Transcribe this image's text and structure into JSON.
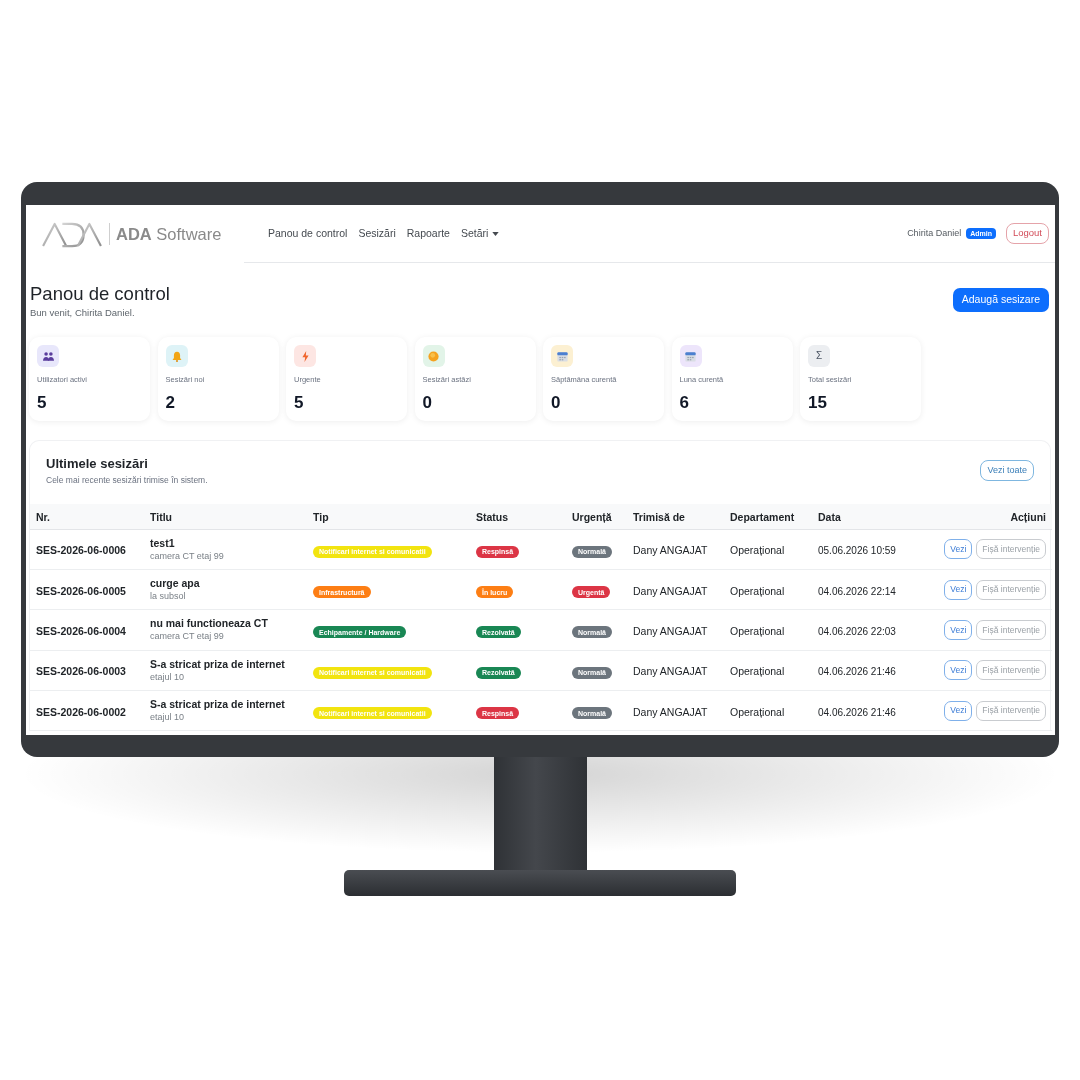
{
  "header": {
    "brand": "**ADA** Software",
    "nav": [
      {
        "label": "Panou de control",
        "dropdown": false
      },
      {
        "label": "Sesizări",
        "dropdown": false
      },
      {
        "label": "Rapoarte",
        "dropdown": false
      },
      {
        "label": "Setări",
        "dropdown": true
      }
    ],
    "user": {
      "name": "Chirita Daniel",
      "role": "Admin"
    },
    "logout": "Logout"
  },
  "page": {
    "title": "Panou de control",
    "subtitle": "Bun venit, Chirita Daniel.",
    "add_button": "Adaugă sesizare"
  },
  "stats": [
    {
      "kind": "users",
      "color": "#e8e7fb",
      "label": "Utilizatori activi",
      "value": "5"
    },
    {
      "kind": "bell",
      "color": "#def3f7",
      "label": "Sesizări noi",
      "value": "2"
    },
    {
      "kind": "bolt",
      "color": "#fde6e3",
      "label": "Urgente",
      "value": "5"
    },
    {
      "kind": "sun",
      "color": "#e2f4e8",
      "label": "Sesizări astăzi",
      "value": "0"
    },
    {
      "kind": "calendar",
      "color": "#fcf0d2",
      "label": "Săptămâna curentă",
      "value": "0"
    },
    {
      "kind": "calendar",
      "color": "#ede5fb",
      "label": "Luna curentă",
      "value": "6"
    },
    {
      "kind": "symbol",
      "symbol": "Σ",
      "color": "#eceef1",
      "label": "Total sesizări",
      "value": "15"
    }
  ],
  "recent": {
    "title": "Ultimele sesizări",
    "subtitle": "Cele mai recente sesizări trimise în sistem.",
    "view_all": "Vezi toate",
    "columns": [
      "Nr.",
      "Titlu",
      "Tip",
      "Status",
      "Urgență",
      "Trimisă de",
      "Departament",
      "Data",
      "Acțiuni"
    ],
    "rows": [
      {
        "nr": "SES-2026-06-0006",
        "title": "test1",
        "location": "camera CT etaj 99",
        "type": {
          "label": "Notificari internet si comunicatii",
          "color": "#f2e40f"
        },
        "status": {
          "label": "Respinsă",
          "color": "#dc3545"
        },
        "urgency": {
          "label": "Normală",
          "color": "#6c757d"
        },
        "sender": "Dany ANGAJAT",
        "department": "Operațional",
        "date": "05.06.2026 10:59",
        "actions": [
          {
            "kind": "view",
            "label": "Vezi"
          },
          {
            "kind": "sheet",
            "label": "Fișă intervenție"
          }
        ]
      },
      {
        "nr": "SES-2026-06-0005",
        "title": "curge apa",
        "location": "la subsol",
        "type": {
          "label": "Infrastructură",
          "color": "#fd7e14"
        },
        "status": {
          "label": "În lucru",
          "color": "#fd7e14"
        },
        "urgency": {
          "label": "Urgentă",
          "color": "#dc3545"
        },
        "sender": "Dany ANGAJAT",
        "department": "Operațional",
        "date": "04.06.2026 22:14",
        "actions": [
          {
            "kind": "view",
            "label": "Vezi"
          },
          {
            "kind": "sheet",
            "label": "Fișă intervenție"
          }
        ]
      },
      {
        "nr": "SES-2026-06-0004",
        "title": "nu mai functioneaza CT",
        "location": "camera CT etaj 99",
        "type": {
          "label": "Echipamente / Hardware",
          "color": "#198754"
        },
        "status": {
          "label": "Rezolvată",
          "color": "#198754"
        },
        "urgency": {
          "label": "Normală",
          "color": "#6c757d"
        },
        "sender": "Dany ANGAJAT",
        "department": "Operațional",
        "date": "04.06.2026 22:03",
        "actions": [
          {
            "kind": "view",
            "label": "Vezi"
          },
          {
            "kind": "sheet",
            "label": "Fișă intervenție"
          }
        ]
      },
      {
        "nr": "SES-2026-06-0003",
        "title": "S-a stricat priza de internet",
        "location": "etajul 10",
        "type": {
          "label": "Notificari internet si comunicatii",
          "color": "#f2e40f"
        },
        "status": {
          "label": "Rezolvată",
          "color": "#198754"
        },
        "urgency": {
          "label": "Normală",
          "color": "#6c757d"
        },
        "sender": "Dany ANGAJAT",
        "department": "Operațional",
        "date": "04.06.2026 21:46",
        "actions": [
          {
            "kind": "view",
            "label": "Vezi"
          },
          {
            "kind": "sheet",
            "label": "Fișă intervenție"
          }
        ]
      },
      {
        "nr": "SES-2026-06-0002",
        "title": "S-a stricat priza de internet",
        "location": "etajul 10",
        "type": {
          "label": "Notificari internet si comunicatii",
          "color": "#f2e40f"
        },
        "status": {
          "label": "Respinsă",
          "color": "#dc3545"
        },
        "urgency": {
          "label": "Normală",
          "color": "#6c757d"
        },
        "sender": "Dany ANGAJAT",
        "department": "Operațional",
        "date": "04.06.2026 21:46",
        "actions": [
          {
            "kind": "view",
            "label": "Vezi"
          },
          {
            "kind": "sheet",
            "label": "Fișă intervenție"
          }
        ]
      }
    ]
  }
}
